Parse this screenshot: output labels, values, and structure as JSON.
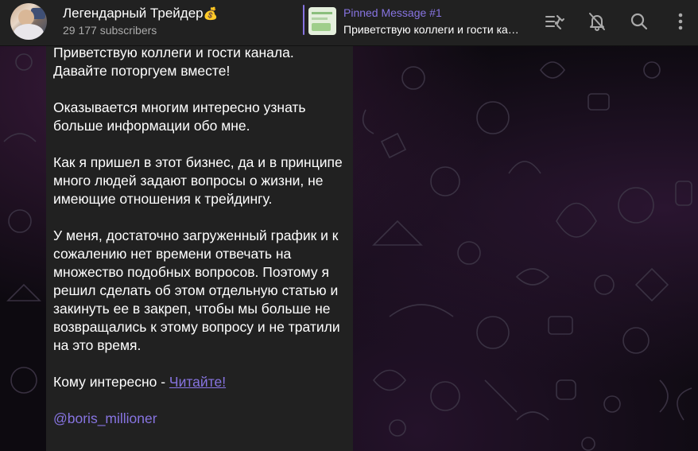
{
  "header": {
    "channel_title": "Легендарный Трейдер",
    "channel_emoji": "💰",
    "subscribers": "29 177 subscribers",
    "pinned": {
      "label": "Pinned Message #1",
      "preview": "Приветствую коллеги и гости канала."
    },
    "icons": [
      "pinned-list-icon",
      "mute-bell-icon",
      "search-icon",
      "more-vertical-icon"
    ]
  },
  "message": {
    "p1_line1": "Приветствую коллеги и гости канала.",
    "p1_line2": "Давайте поторгуем вместе!",
    "p2": "Оказывается многим интересно узнать больше информации обо мне.",
    "p3": "Как я пришел в этот бизнес, да и в принципе много людей задают вопросы о жизни, не имеющие отношения к трейдингу.",
    "p4": "У меня, достаточно загруженный график и к сожалению нет времени отвечать на множество подобных вопросов. Поэтому я решил сделать об этом отдельную статью и закинуть ее в закреп, чтобы мы больше не возвращались к этому вопросу и не тратили на это время.",
    "p5_prefix": "Кому интересно - ",
    "p5_link": "Читайте!",
    "mention": "@boris_millioner"
  },
  "colors": {
    "accent": "#8774e1",
    "header_bg": "#212121",
    "bubble_bg": "#212121",
    "text": "#ffffff",
    "subtext": "#aaaaaa"
  }
}
